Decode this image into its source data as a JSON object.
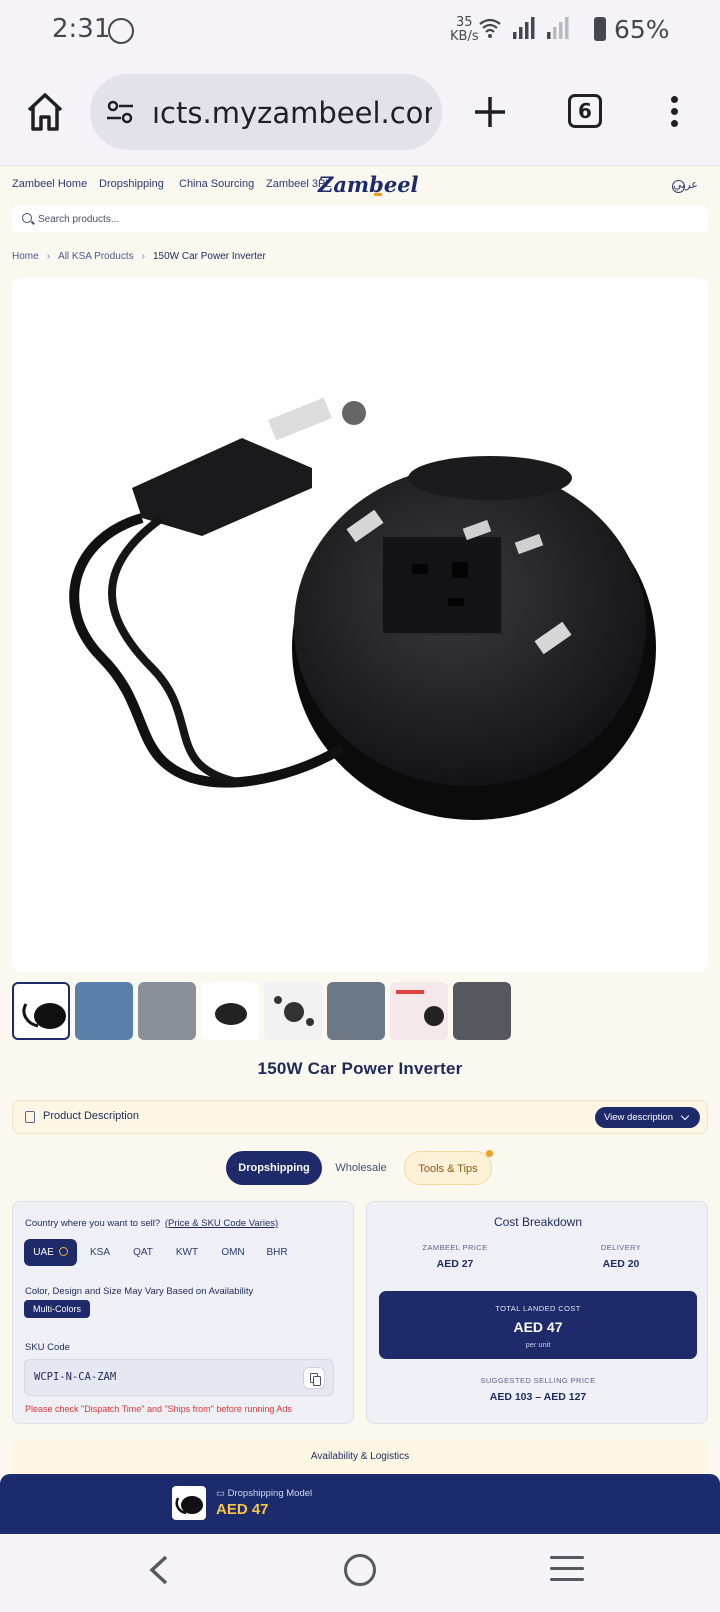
{
  "status": {
    "time": "2:31",
    "net_speed_value": "35",
    "net_speed_unit": "KB/s",
    "battery": "65%"
  },
  "browser": {
    "url": "ıcts.myzambeel.com",
    "tab_count": "6"
  },
  "nav": {
    "links": [
      "Zambeel Home",
      "Dropshipping",
      "China Sourcing",
      "Zambeel 3PL"
    ],
    "logo": "Zambeel",
    "language": "عربي"
  },
  "search": {
    "placeholder": "Search products..."
  },
  "breadcrumb": {
    "home": "Home",
    "category": "All KSA Products",
    "current": "150W Car Power Inverter"
  },
  "product": {
    "title": "150W Car Power Inverter",
    "description_label": "Product Description",
    "view_description": "View description"
  },
  "tabs": {
    "dropshipping": "Dropshipping",
    "wholesale": "Wholesale",
    "tools": "Tools & Tips"
  },
  "selling": {
    "question": "Country where you want to sell?",
    "note": "(Price & SKU Code Varies)",
    "countries": [
      "UAE",
      "KSA",
      "QAT",
      "KWT",
      "OMN",
      "BHR"
    ],
    "variation_note": "Color, Design and Size May Vary Based on Availability",
    "variant": "Multi-Colors",
    "sku_label": "SKU Code",
    "sku_value": "WCPI-N-CA-ZAM",
    "warning": "Please check \"Dispatch Time\" and \"Ships from\" before running Ads"
  },
  "cost": {
    "title": "Cost Breakdown",
    "zambeel_label": "ZAMBEEL PRICE",
    "zambeel_value": "AED 27",
    "delivery_label": "DELIVERY",
    "delivery_value": "AED 20",
    "total_label": "TOTAL LANDED COST",
    "total_value": "AED 47",
    "per_unit": "per unit",
    "suggested_label": "SUGGESTED SELLING PRICE",
    "suggested_value": "AED 103 – AED 127"
  },
  "availability": "Availability & Logistics",
  "sticky": {
    "model": "Dropshipping Model",
    "price": "AED 47"
  },
  "colors": {
    "navy": "#1e2a6a",
    "accent": "#f0a020",
    "warning": "#d63a3a"
  }
}
